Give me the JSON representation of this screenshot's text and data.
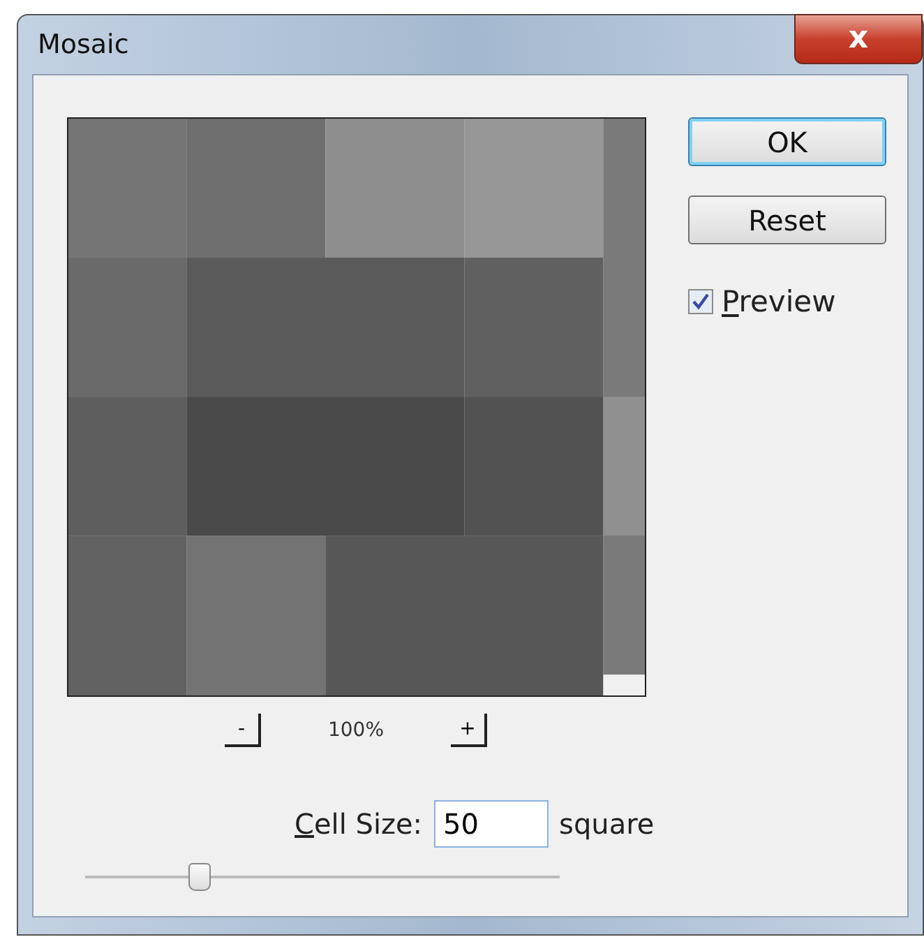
{
  "window": {
    "title": "Mosaic",
    "close_glyph": "x"
  },
  "zoom": {
    "minus": "-",
    "value": "100%",
    "plus": "+"
  },
  "buttons": [
    {
      "label": "OK",
      "default": true
    },
    {
      "label": "Reset",
      "default": false
    }
  ],
  "preview_checkbox": {
    "label": "Preview",
    "checked": true
  },
  "cell_size": {
    "label": "Cell Size:",
    "value": "50",
    "unit": "square"
  },
  "slider": {
    "level": 0.24
  }
}
